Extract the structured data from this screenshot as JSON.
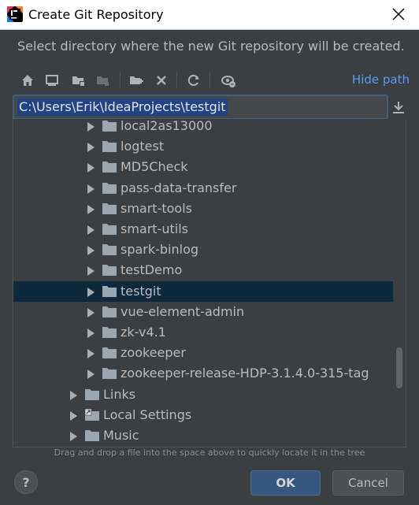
{
  "window": {
    "title": "Create Git Repository",
    "icon": "intellij-idea-icon"
  },
  "subtitle": "Select directory where the new Git repository will be created.",
  "toolbar": {
    "buttons": [
      "home-icon",
      "desktop-icon",
      "project-folder-icon",
      "module-folder-icon",
      "new-folder-icon",
      "delete-icon",
      "refresh-icon",
      "show-hidden-icon"
    ],
    "hide_path": "Hide path"
  },
  "path": {
    "value": "C:\\Users\\Erik\\IdeaProjects\\testgit"
  },
  "tree": {
    "items": [
      {
        "label": "local2as13000",
        "level": 2,
        "selected": false
      },
      {
        "label": "logtest",
        "level": 2,
        "selected": false
      },
      {
        "label": "MD5Check",
        "level": 2,
        "selected": false
      },
      {
        "label": "pass-data-transfer",
        "level": 2,
        "selected": false
      },
      {
        "label": "smart-tools",
        "level": 2,
        "selected": false
      },
      {
        "label": "smart-utils",
        "level": 2,
        "selected": false
      },
      {
        "label": "spark-binlog",
        "level": 2,
        "selected": false
      },
      {
        "label": "testDemo",
        "level": 2,
        "selected": false
      },
      {
        "label": "testgit",
        "level": 2,
        "selected": true
      },
      {
        "label": "vue-element-admin",
        "level": 2,
        "selected": false
      },
      {
        "label": "zk-v4.1",
        "level": 2,
        "selected": false
      },
      {
        "label": "zookeeper",
        "level": 2,
        "selected": false
      },
      {
        "label": "zookeeper-release-HDP-3.1.4.0-315-tag",
        "level": 2,
        "selected": false
      },
      {
        "label": "Links",
        "level": 1,
        "selected": false
      },
      {
        "label": "Local Settings",
        "level": 1,
        "selected": false,
        "shortcut": true
      },
      {
        "label": "Music",
        "level": 1,
        "selected": false
      }
    ]
  },
  "hint": "Drag and drop a file into the space above to quickly locate it in the tree",
  "buttons": {
    "help": "?",
    "ok": "OK",
    "cancel": "Cancel"
  },
  "colors": {
    "background": "#3c3f41",
    "selection": "#0d293e",
    "link": "#589df6",
    "primary_button": "#365880"
  }
}
